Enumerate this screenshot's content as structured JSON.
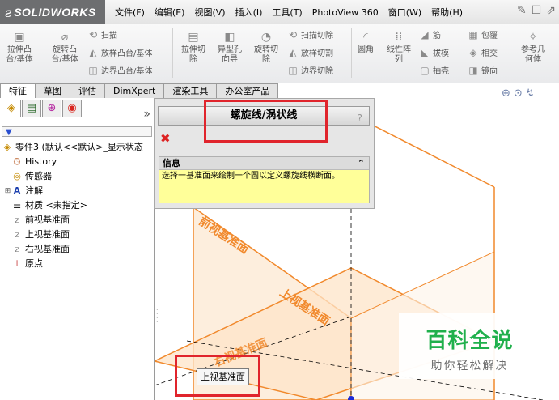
{
  "app": {
    "logo_mark": "ƨ",
    "logo_text": "SOLIDWORKS"
  },
  "menus": [
    "文件(F)",
    "编辑(E)",
    "视图(V)",
    "插入(I)",
    "工具(T)",
    "PhotoView 360",
    "窗口(W)",
    "帮助(H)"
  ],
  "ribbon": {
    "extrude_boss": "拉伸凸\n台/基体",
    "revolve_boss": "旋转凸\n台/基体",
    "sweep": "扫描",
    "loft": "放样凸台/基体",
    "boundary_boss": "边界凸台/基体",
    "extrude_cut": "拉伸切\n除",
    "hole_wizard": "异型孔\n向导",
    "revolve_cut": "旋转切\n除",
    "swept_cut": "扫描切除",
    "lofted_cut": "放样切割",
    "boundary_cut": "边界切除",
    "fillet": "圆角",
    "linear_pattern": "线性阵\n列",
    "rib": "筋",
    "draft": "拔模",
    "shell": "抽壳",
    "wrap": "包覆",
    "intersect": "相交",
    "mirror": "镜向",
    "ref_geometry": "参考几\n何体"
  },
  "tabs": [
    "特征",
    "草图",
    "评估",
    "DimXpert",
    "渲染工具",
    "办公室产品"
  ],
  "feature_tree": {
    "filter_icon": "▼",
    "part": "零件3  (默认<<默认>_显示状态",
    "items": [
      "History",
      "传感器",
      "注解",
      "材质 <未指定>",
      "前视基准面",
      "上视基准面",
      "右视基准面",
      "原点"
    ]
  },
  "property_manager": {
    "title": "螺旋线/涡状线",
    "help": "?",
    "close": "✖",
    "info_header": "信息",
    "info_arrow": "⌃",
    "info_text": "选择一基准面来绘制一个圆以定义螺旋线横断面。"
  },
  "graphics": {
    "front_plane": "前视基准面",
    "top_plane": "上视基准面",
    "right_plane": "右视基准面",
    "tooltip": "上视基准面",
    "plane_color": "#f1892c"
  },
  "watermark": {
    "title": "百科全说",
    "subtitle": "助你轻松解决"
  }
}
